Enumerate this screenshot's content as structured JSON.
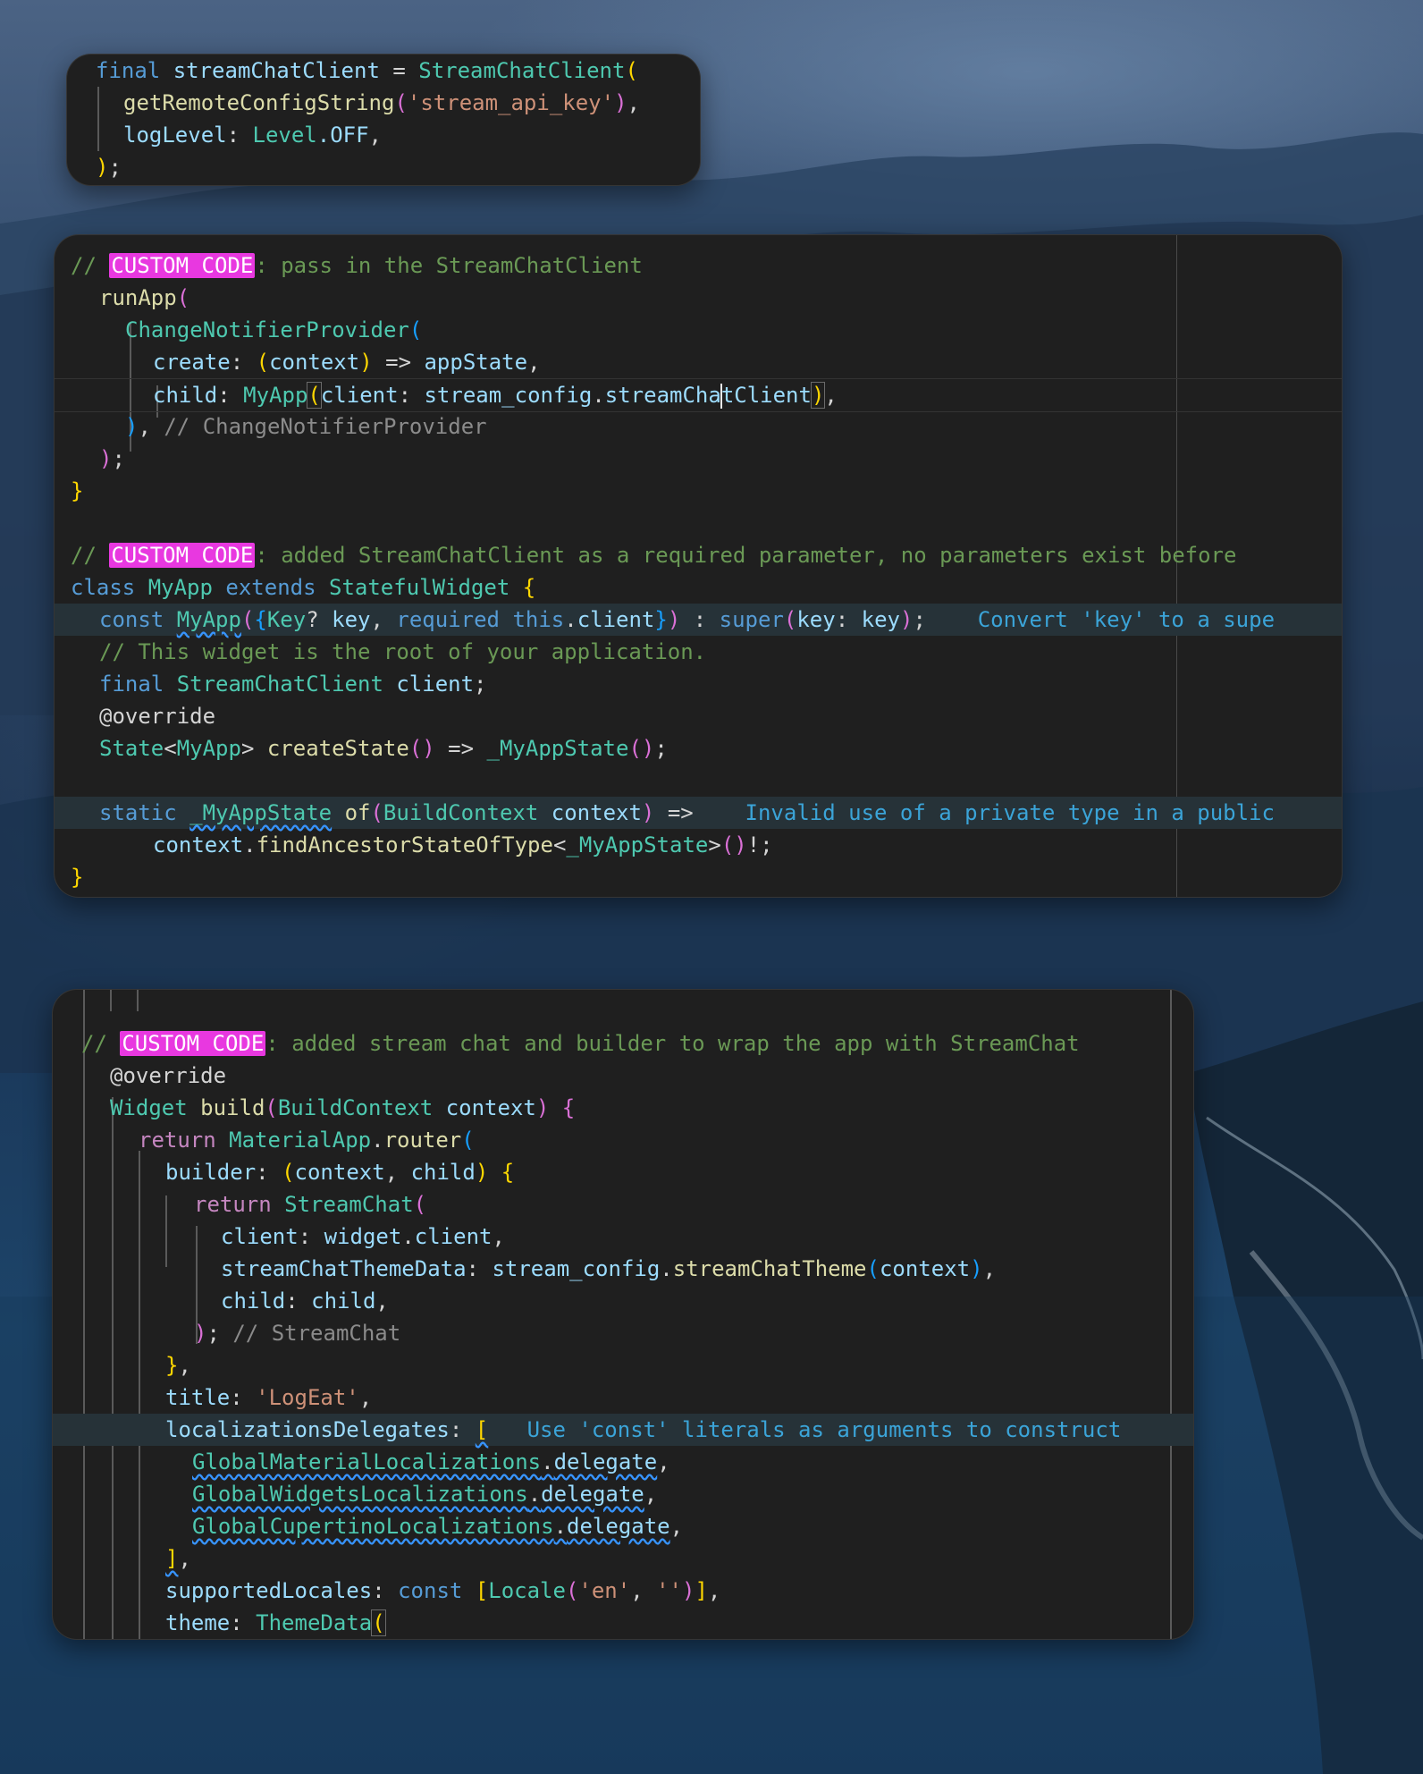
{
  "snippet1": {
    "l1": [
      "final",
      "streamChatClient",
      "=",
      "StreamChatClient",
      "("
    ],
    "l2": [
      "getRemoteConfigString",
      "(",
      "'stream_api_key'",
      ")",
      ","
    ],
    "l3": [
      "logLevel",
      ":",
      "Level",
      ".OFF",
      ","
    ],
    "l4": [
      ")",
      ";"
    ]
  },
  "snippet2": {
    "c1": [
      "// ",
      "CUSTOM CODE",
      ": pass in the StreamChatClient"
    ],
    "l2": [
      "runApp",
      "("
    ],
    "l3": [
      "ChangeNotifierProvider",
      "("
    ],
    "l4": [
      "create",
      ": ",
      "(",
      "context",
      ")",
      " => ",
      "appState",
      ","
    ],
    "l5": [
      "child",
      ": ",
      "MyApp",
      "(",
      "client",
      ": ",
      "stream_config",
      ".",
      "streamCha",
      "tClient",
      ")",
      ","
    ],
    "l6": [
      ")",
      ", ",
      "// ChangeNotifierProvider"
    ],
    "l7": [
      ")",
      ";"
    ],
    "l8": [
      "}"
    ],
    "c2": [
      "// ",
      "CUSTOM CODE",
      ": added StreamChatClient as a required parameter, no parameters exist before"
    ],
    "l10": [
      "class",
      " MyApp ",
      "extends",
      " StatefulWidget ",
      "{"
    ],
    "l11": [
      "const",
      " ",
      "MyApp",
      "(",
      "{",
      "Key",
      "? ",
      "key",
      ", ",
      "required",
      " ",
      "this",
      ".",
      "client",
      "}",
      ")",
      " : ",
      "super",
      "(",
      "key",
      ": ",
      "key",
      ")",
      ";",
      "Convert 'key' to a supe"
    ],
    "l12": [
      "// This widget is the root of your application."
    ],
    "l13": [
      "final",
      " StreamChatClient ",
      "client",
      ";"
    ],
    "l14": [
      "@override"
    ],
    "l15": [
      "State",
      "<",
      "MyApp",
      "> ",
      "createState",
      "(",
      ")",
      " => ",
      "_MyAppState",
      "(",
      ")",
      ";"
    ],
    "l17": [
      "static",
      " ",
      "_MyAppState",
      " ",
      "of",
      "(",
      "BuildContext",
      " ",
      "context",
      ")",
      " =>",
      "Invalid use of a private type in a public"
    ],
    "l18": [
      "context",
      ".",
      "findAncestorStateOfType",
      "<",
      "_MyAppState",
      ">",
      "(",
      ")",
      "!;"
    ],
    "l19": [
      "}"
    ]
  },
  "snippet3": {
    "c1": [
      "// ",
      "CUSTOM CODE",
      ": added stream chat and builder to wrap the app with StreamChat"
    ],
    "l2": [
      "@override"
    ],
    "l3": [
      "Widget",
      " ",
      "build",
      "(",
      "BuildContext",
      " ",
      "context",
      ")",
      " ",
      "{"
    ],
    "l4": [
      "return",
      " ",
      "MaterialApp",
      ".",
      "router",
      "("
    ],
    "l5": [
      "builder",
      ": ",
      "(",
      "context",
      ", ",
      "child",
      ")",
      " ",
      "{"
    ],
    "l6": [
      "return",
      " ",
      "StreamChat",
      "("
    ],
    "l7": [
      "client",
      ": ",
      "widget",
      ".",
      "client",
      ","
    ],
    "l8": [
      "streamChatThemeData",
      ": ",
      "stream_config",
      ".",
      "streamChatTheme",
      "(",
      "context",
      ")",
      ","
    ],
    "l9": [
      "child",
      ": ",
      "child",
      ","
    ],
    "l10": [
      ")",
      "; ",
      "// StreamChat"
    ],
    "l11": [
      "}",
      ","
    ],
    "l12": [
      "title",
      ": ",
      "'LogEat'",
      ","
    ],
    "l13": [
      "localizationsDelegates",
      ": ",
      "[",
      "Use 'const' literals as arguments to construct"
    ],
    "l14": [
      "GlobalMaterialLocalizations",
      ".",
      "delegate",
      ","
    ],
    "l15": [
      "GlobalWidgetsLocalizations",
      ".",
      "delegate",
      ","
    ],
    "l16": [
      "GlobalCupertinoLocalizations",
      ".",
      "delegate",
      ","
    ],
    "l17": [
      "]",
      ","
    ],
    "l18": [
      "supportedLocales",
      ": ",
      "const",
      " ",
      "[",
      "Locale",
      "(",
      "'en'",
      ", ",
      "''",
      ")",
      "]",
      ","
    ],
    "l19": [
      "theme",
      ": ",
      "ThemeData",
      "("
    ]
  },
  "colors": {
    "keyword": "#569cd6",
    "control": "#c586c0",
    "type": "#4ec9b0",
    "function": "#dcdcaa",
    "string": "#ce9178",
    "variable": "#9cdcfe",
    "comment": "#6a9955",
    "hint": "#3ba4d8",
    "bracket_yellow": "#ffd700",
    "bracket_pink": "#da70d6",
    "bracket_blue": "#179fff",
    "custom_code_tag": "#e838e0",
    "panel_bg": "#1f1f1f"
  }
}
